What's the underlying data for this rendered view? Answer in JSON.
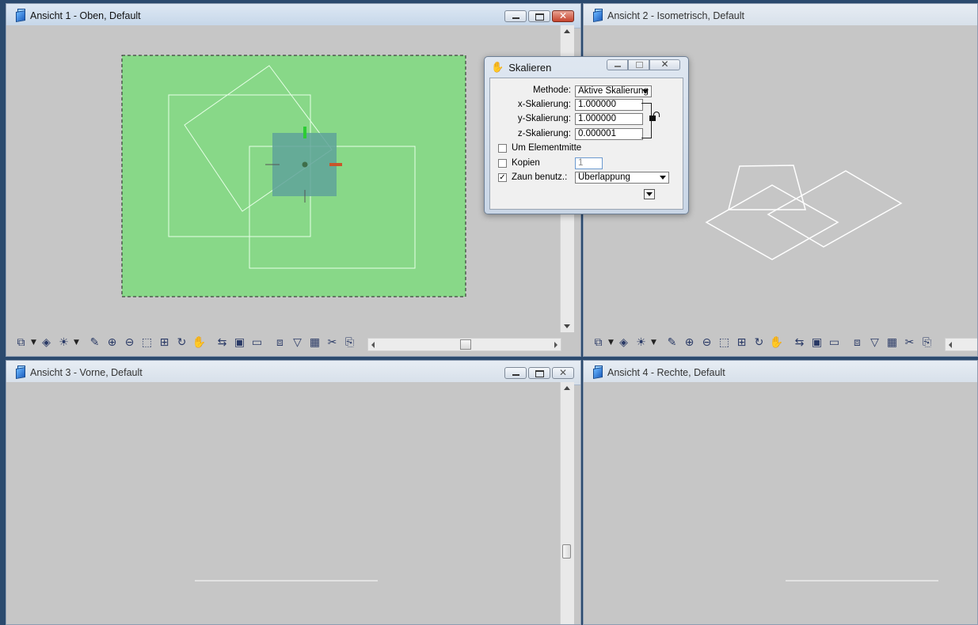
{
  "views": [
    {
      "title": "Ansicht 1 - Oben, Default"
    },
    {
      "title": "Ansicht 2 - Isometrisch, Default"
    },
    {
      "title": "Ansicht 3 - Vorne, Default"
    },
    {
      "title": "Ansicht 4 - Rechte, Default"
    }
  ],
  "colors": {
    "view_bg": "#c6c6c6",
    "fence_fill": "#88d888",
    "element_line": "#e6ffe6",
    "selection_box": "#5fa39a",
    "x_axis": "#c9562a",
    "y_axis": "#2ccc34"
  },
  "toolbar_icons": [
    "view-attributes-icon",
    "display-style-icon",
    "lighting-icon",
    "update-view-icon",
    "zoom-in-icon",
    "zoom-out-icon",
    "window-area-icon",
    "fit-view-icon",
    "rotate-view-icon",
    "pan-view-icon",
    "view-previous-icon",
    "view-next-icon",
    "clip-volume-icon",
    "camera-icon",
    "filter-icon",
    "display-set-icon",
    "tools-icon",
    "save-view-icon"
  ],
  "dialog": {
    "title": "Skalieren",
    "methode_label": "Methode:",
    "methode_value": "Aktive Skalierung",
    "x_label": "x-Skalierung:",
    "x_value": "1.000000",
    "y_label": "y-Skalierung:",
    "y_value": "1.000000",
    "z_label": "z-Skalierung:",
    "z_value": "0.000001",
    "um_elementmitte_label": "Um Elementmitte",
    "um_elementmitte_checked": false,
    "kopien_label": "Kopien",
    "kopien_checked": false,
    "kopien_value": "1",
    "zaun_label": "Zaun benutz.:",
    "zaun_checked": true,
    "zaun_value": "Überlappung"
  }
}
